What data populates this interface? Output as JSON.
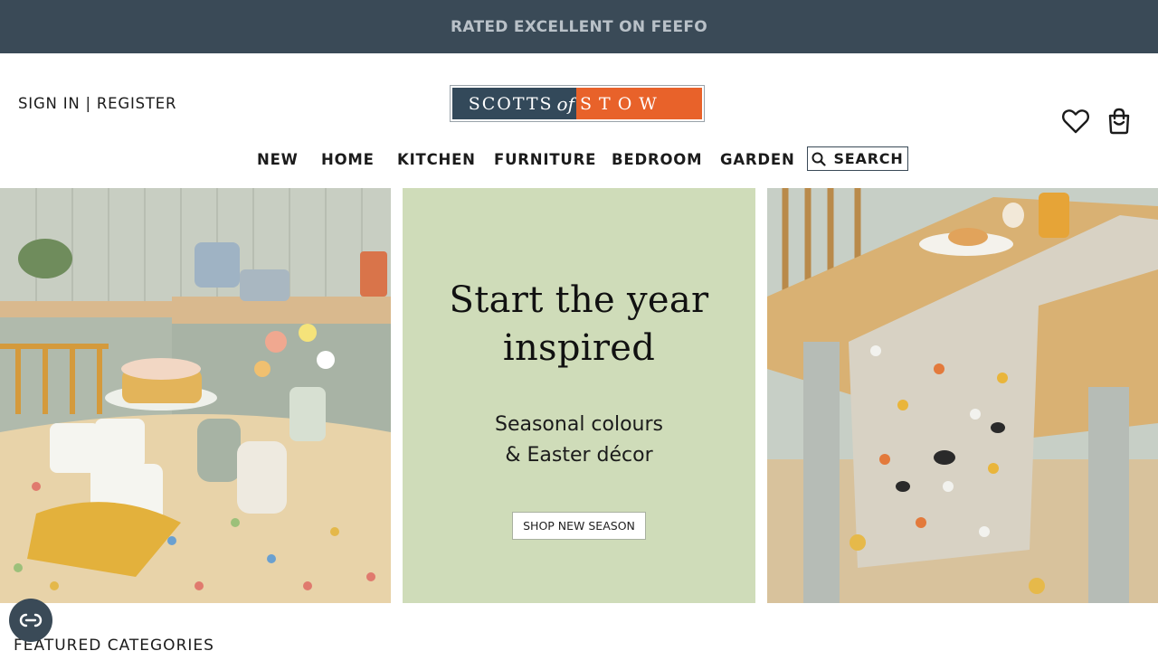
{
  "promo_bar": {
    "text": "RATED EXCELLENT ON FEEFO"
  },
  "account": {
    "sign_in": "SIGN IN",
    "separator": "|",
    "register": "REGISTER"
  },
  "logo": {
    "left": "SCOTTS",
    "of": "of",
    "right": "STOW",
    "colors": {
      "navy": "#33495a",
      "orange": "#e8622a"
    }
  },
  "header_icons": [
    "heart-icon",
    "shopping-bag-icon"
  ],
  "nav": {
    "items": [
      "NEW",
      "HOME",
      "KITCHEN",
      "FURNITURE",
      "BEDROOM",
      "GARDEN"
    ],
    "search_label": "SEARCH"
  },
  "hero": {
    "headline_line1": "Start the year",
    "headline_line2": "inspired",
    "sub_line1": "Seasonal colours",
    "sub_line2": "& Easter décor",
    "cta": "SHOP NEW SEASON",
    "panel_color": "#cfdcb9"
  },
  "section_title": "FEATURED CATEGORIES",
  "theme": {
    "topbar": "#3a4a57",
    "topbar_text": "#b9c1c8"
  }
}
